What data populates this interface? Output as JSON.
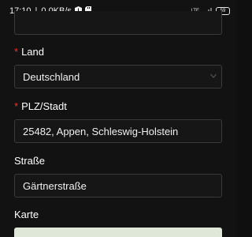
{
  "status_bar": {
    "time": "17:10",
    "separator": "|",
    "speed": "0,0KB/s",
    "network": "LTE",
    "battery": "59"
  },
  "form": {
    "land": {
      "required_mark": "*",
      "label": "Land",
      "value": "Deutschland"
    },
    "plz_stadt": {
      "required_mark": "*",
      "label": "PLZ/Stadt",
      "value": "25482, Appen, Schleswig-Holstein"
    },
    "strasse": {
      "label": "Straße",
      "value": "Gärtnerstraße"
    },
    "karte": {
      "label": "Karte"
    }
  }
}
